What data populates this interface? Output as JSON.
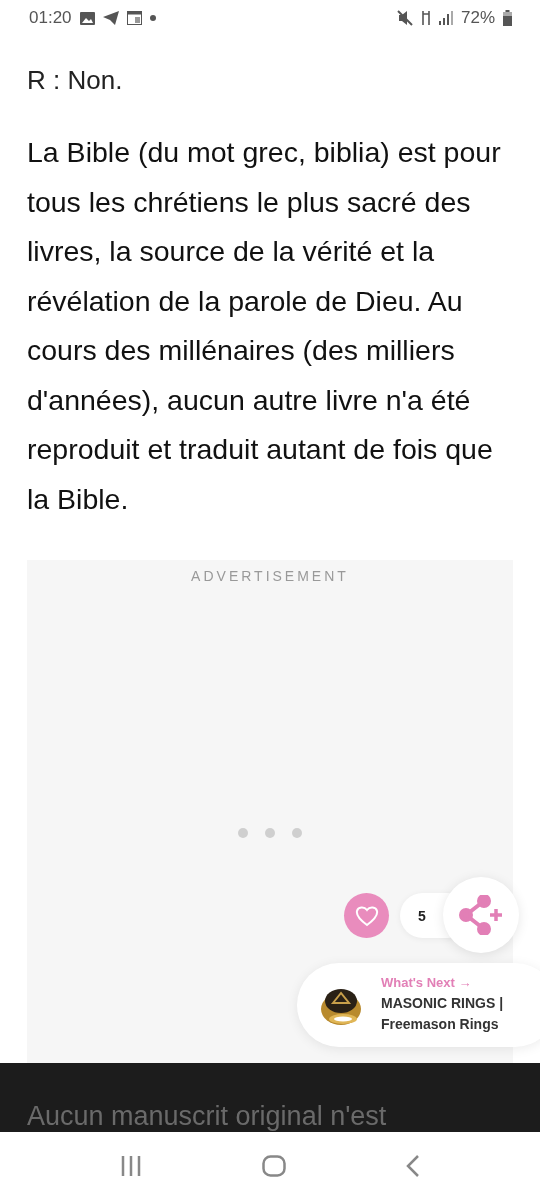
{
  "status_bar": {
    "time": "01:20",
    "battery": "72%"
  },
  "article": {
    "answer": "R : Non.",
    "paragraph": "La Bible (du mot grec, biblia) est pour tous les chrétiens le plus sacré des livres, la source de la vérité et la révélation de la parole de Dieu. Au cours des millénaires (des milliers d'années), aucun autre livre n'a été reproduit et traduit autant de fois que la Bible."
  },
  "ad": {
    "label": "ADVERTISEMENT"
  },
  "reactions": {
    "liked": false,
    "count": "5"
  },
  "whats_next": {
    "heading": "What's Next",
    "arrow": "→",
    "title": "MASONIC RINGS | Freemason Rings"
  },
  "overlay_text": "Aucun manuscrit original n'est"
}
